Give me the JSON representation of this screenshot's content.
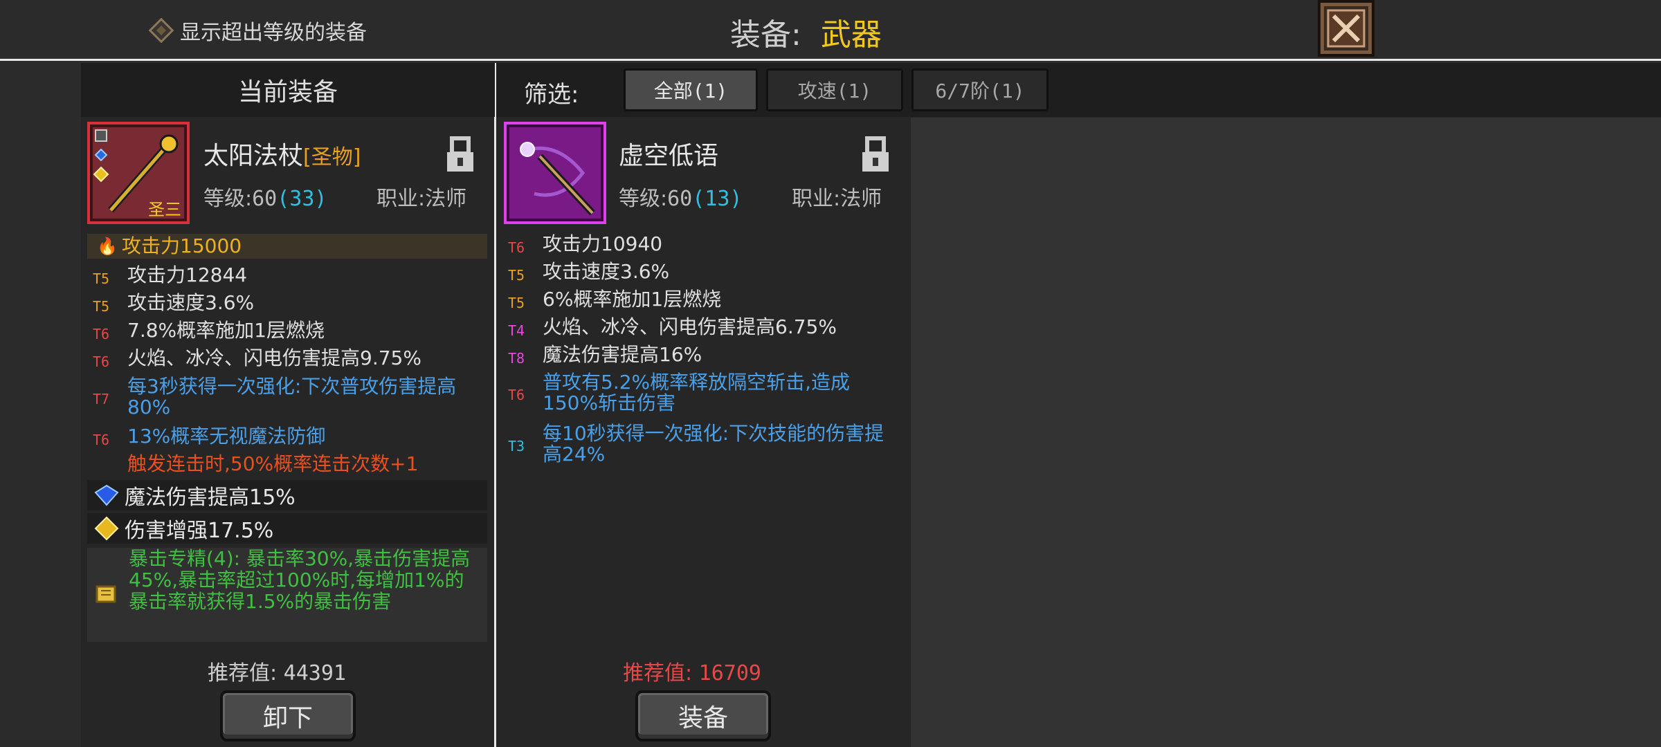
{
  "topbar": {
    "toggle_label": "显示超出等级的装备",
    "title_label": "装备:",
    "title_value": "武器"
  },
  "left": {
    "header": "当前装备",
    "item_name": "太阳法杖",
    "item_tag": "[圣物]",
    "icon_badge": "圣三",
    "level_label": "等级:",
    "level_value": "60",
    "level_extra": "(33)",
    "class_label": "职业:",
    "class_value": "法师",
    "main_stat": "攻击力15000",
    "stats": [
      {
        "tier": "T5",
        "text": "攻击力12844"
      },
      {
        "tier": "T5",
        "text": "攻击速度3.6%"
      },
      {
        "tier": "T6",
        "text": "7.8%概率施加1层燃烧"
      },
      {
        "tier": "T6",
        "text": "火焰、冰冷、闪电伤害提高9.75%"
      },
      {
        "tier": "T7",
        "text": "每3秒获得一次强化:下次普攻伤害提高80%"
      },
      {
        "tier": "T6",
        "text": "13%概率无视魔法防御"
      },
      {
        "tier": "",
        "text": "触发连击时,50%概率连击次数+1"
      }
    ],
    "gems": [
      {
        "icon": "sapphire-gem-icon",
        "text": "魔法伤害提高15%"
      },
      {
        "icon": "topaz-gem-icon",
        "text": "伤害增强17.5%"
      }
    ],
    "set_text": "暴击专精(4): 暴击率30%,暴击伤害提高45%,暴击率超过100%时,每增加1%的暴击率就获得1.5%的暴击伤害",
    "recommend_label": "推荐值:",
    "recommend_value": "44391",
    "button": "卸下"
  },
  "filter": {
    "label": "筛选:",
    "chips": [
      "全部(1)",
      "攻速(1)",
      "6/7阶(1)"
    ]
  },
  "right": {
    "item_name": "虚空低语",
    "level_label": "等级:",
    "level_value": "60",
    "level_extra": "(13)",
    "class_label": "职业:",
    "class_value": "法师",
    "stats": [
      {
        "tier": "T6",
        "text": "攻击力10940"
      },
      {
        "tier": "T5",
        "text": "攻击速度3.6%"
      },
      {
        "tier": "T5",
        "text": "6%概率施加1层燃烧"
      },
      {
        "tier": "T4",
        "text": "火焰、冰冷、闪电伤害提高6.75%"
      },
      {
        "tier": "T8",
        "text": "魔法伤害提高16%"
      },
      {
        "tier": "T6",
        "text": "普攻有5.2%概率释放隔空斩击,造成150%斩击伤害"
      },
      {
        "tier": "T3",
        "text": "每10秒获得一次强化:下次技能的伤害提高24%"
      }
    ],
    "recommend_label": "推荐值:",
    "recommend_value": "16709",
    "button": "装备"
  },
  "colors": {
    "tier_T3": "#2ec0e0",
    "tier_T4": "#e848e0",
    "tier_T5": "#e8a020",
    "tier_T6": "#e84848",
    "tier_T7": "#e84848",
    "tier_T8": "#e848e0",
    "title_value": "#f2c81e",
    "recommend_low": "#e84848"
  }
}
